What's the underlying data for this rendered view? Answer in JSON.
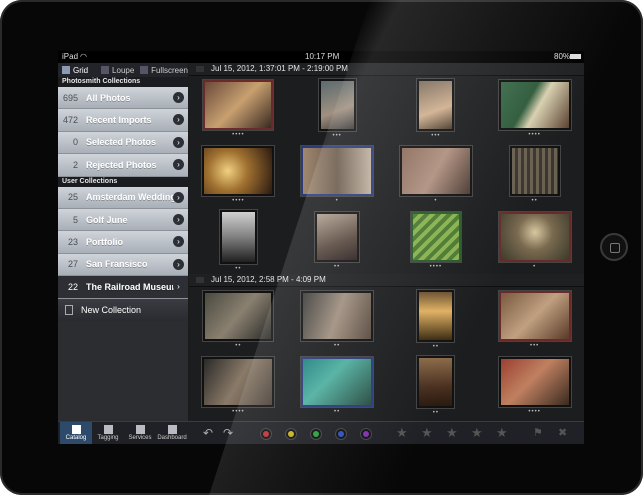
{
  "status": {
    "carrier": "iPad",
    "time": "10:17 PM",
    "battery": "80%"
  },
  "view_modes": [
    {
      "label": "Grid",
      "active": true
    },
    {
      "label": "Loupe",
      "active": false
    },
    {
      "label": "Fullscreen",
      "active": false
    }
  ],
  "sidebar": {
    "photosmith_header": "Photosmith Collections",
    "photosmith": [
      {
        "count": "695",
        "label": "All Photos"
      },
      {
        "count": "472",
        "label": "Recent Imports"
      },
      {
        "count": "0",
        "label": "Selected Photos"
      },
      {
        "count": "2",
        "label": "Rejected Photos"
      }
    ],
    "user_header": "User Collections",
    "user": [
      {
        "count": "25",
        "label": "Amsterdam Wedding"
      },
      {
        "count": "5",
        "label": "Golf June"
      },
      {
        "count": "23",
        "label": "Portfolio"
      },
      {
        "count": "27",
        "label": "San Fransisco"
      },
      {
        "count": "22",
        "label": "The Railroad Museum",
        "selected": true
      }
    ],
    "new_collection": "New Collection"
  },
  "groups": [
    {
      "header": "Jul 15, 2012, 1:37:01 PM - 2:19:00 PM"
    },
    {
      "header": "Jul 15, 2012, 2:58 PM - 4:09 PM"
    }
  ],
  "tabs": [
    {
      "label": "Catalog",
      "icon": "catalog-icon",
      "active": true
    },
    {
      "label": "Tagging",
      "icon": "tagging-icon",
      "active": false
    },
    {
      "label": "Services",
      "icon": "services-icon",
      "active": false
    },
    {
      "label": "Dashboard",
      "icon": "dashboard-icon",
      "active": false
    }
  ],
  "color_labels": [
    "#c0303a",
    "#c8b020",
    "#2aa040",
    "#3050c0",
    "#8030b0"
  ],
  "stars": 5
}
